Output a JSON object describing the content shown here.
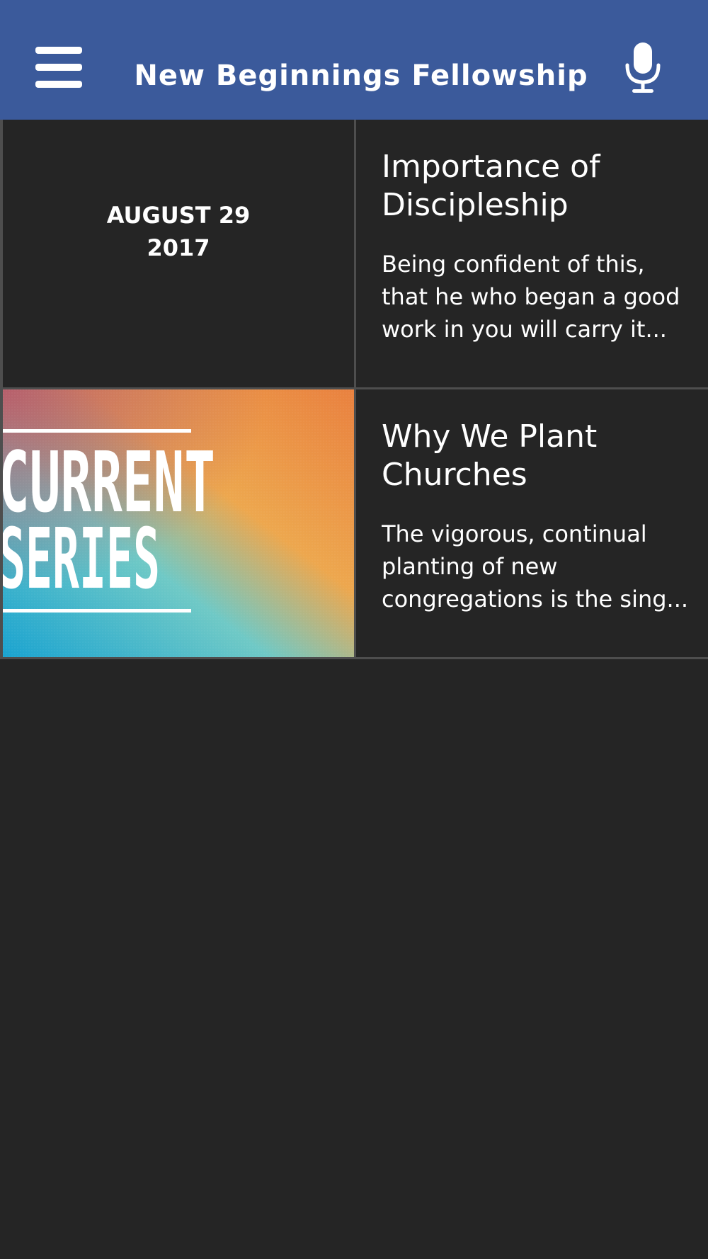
{
  "header": {
    "title": "New Beginnings Fellowship",
    "menu_icon": "hamburger-menu-icon",
    "mic_icon": "microphone-icon",
    "background_color": "#3b5a9b"
  },
  "items": [
    {
      "date_line1": "AUGUST 29",
      "date_line2": "2017",
      "title_line1": "Importance of",
      "title_line2": "Discipleship",
      "desc_line1": "Being confident of this,",
      "desc_line2": "that he who began a good",
      "desc_line3": "work in you will carry it..."
    },
    {
      "image_text_line1": "CURRENT",
      "image_text_line2": "SERIES",
      "title_line1": "Why We Plant",
      "title_line2": "Churches",
      "desc_line1": "The vigorous, continual",
      "desc_line2": "planting of new",
      "desc_line3": "congregations is the sing..."
    }
  ],
  "colors": {
    "background": "#252525",
    "divider": "#4e4e4e",
    "text": "#ffffff"
  }
}
